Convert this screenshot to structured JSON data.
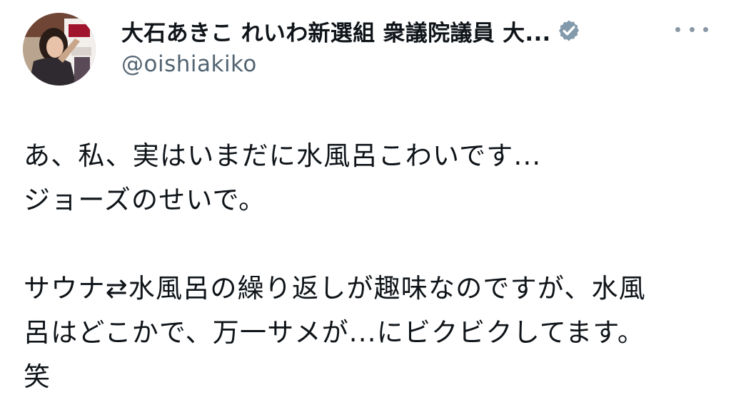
{
  "post": {
    "author": {
      "display_name": "大石あきこ れいわ新選組 衆議院議員 大...",
      "handle": "@oishiakiko",
      "verified_badge_icon": "verified-badge-icon",
      "avatar_icon": "avatar-photo"
    },
    "menu_icon": "more-options-icon",
    "body_lines": [
      "あ、私、実はいまだに水風呂こわいです...",
      "ジョーズのせいで。",
      "",
      "サウナ⇄水風呂の繰り返しが趣味なのですが、水風",
      "呂はどこかで、万一サメが...にビクビクしてます。",
      "笑"
    ]
  },
  "colors": {
    "text": "#0f1419",
    "secondary_text": "#536471",
    "verified_badge": "#829aab",
    "background": "#ffffff"
  }
}
